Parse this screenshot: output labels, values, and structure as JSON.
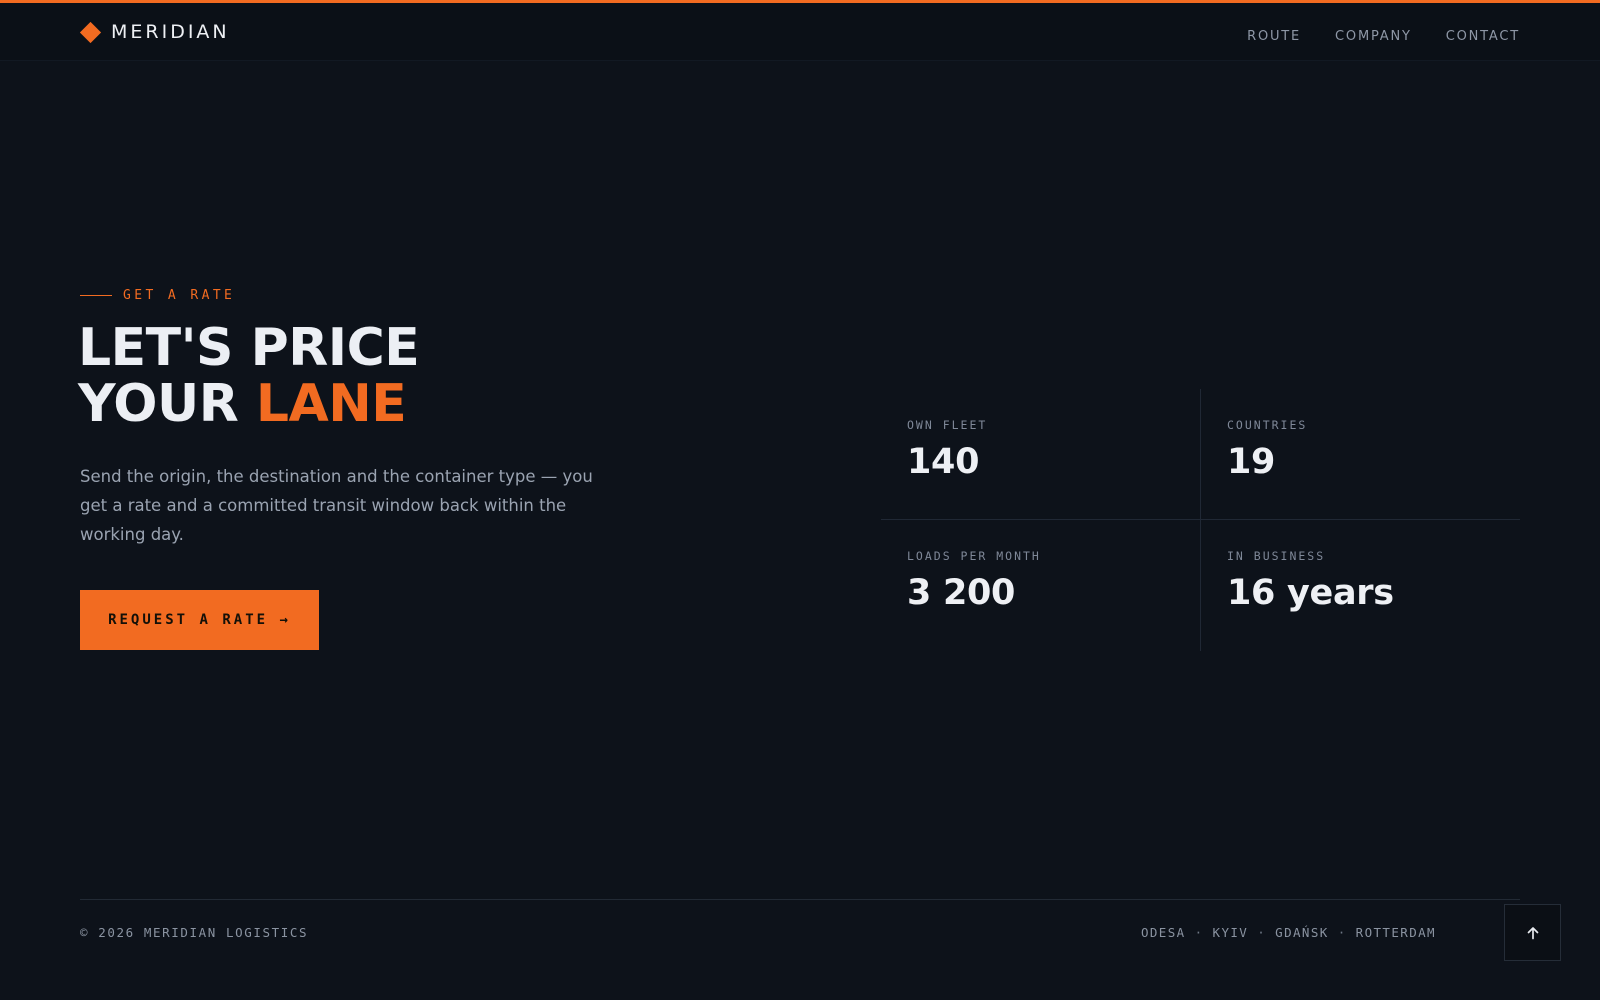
{
  "brand": {
    "name": "MERIDIAN",
    "accent_color": "#f26b21",
    "logo_icon": "diamond-icon"
  },
  "nav": {
    "items": [
      {
        "label": "ROUTE"
      },
      {
        "label": "COMPANY"
      },
      {
        "label": "CONTACT"
      }
    ]
  },
  "hero": {
    "eyebrow": "GET A RATE",
    "headline_line1": "LET'S PRICE",
    "headline_line2_plain": "YOUR ",
    "headline_line2_accent": "LANE",
    "lede": "Send the origin, the destination and the container type — you get a rate and a committed transit window back within the working day.",
    "cta_label": "REQUEST A RATE →"
  },
  "stats": [
    {
      "label": "OWN FLEET",
      "value": "140"
    },
    {
      "label": "COUNTRIES",
      "value": "19"
    },
    {
      "label": "LOADS PER MONTH",
      "value": "3 200"
    },
    {
      "label": "IN BUSINESS",
      "value": "16 years"
    }
  ],
  "footer": {
    "copyright": "© 2026 MERIDIAN LOGISTICS",
    "cities": [
      "ODESA",
      "KYIV",
      "GDAŃSK",
      "ROTTERDAM"
    ],
    "separator": "·",
    "to_top_icon": "arrow-up-icon"
  }
}
